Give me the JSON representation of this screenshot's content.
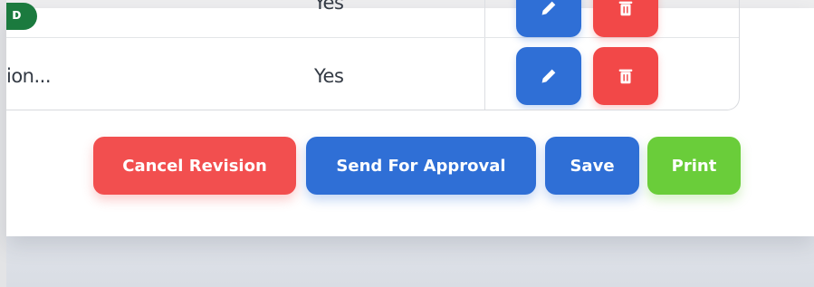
{
  "table": {
    "rows": [
      {
        "name": "",
        "flag": "Yes",
        "actions": {
          "edit_icon": "pencil-icon",
          "delete_icon": "trash-icon"
        }
      },
      {
        "name": "ion...",
        "flag": "Yes",
        "actions": {
          "edit_icon": "pencil-icon",
          "delete_icon": "trash-icon"
        }
      }
    ]
  },
  "footer_actions": {
    "cancel_label": "Cancel Revision",
    "send_label": "Send For Approval",
    "save_label": "Save",
    "print_label": "Print"
  },
  "colors": {
    "primary": "#2f6fd6",
    "danger": "#f24848",
    "success": "#6acd3a",
    "status_green": "#1b7a3e"
  }
}
